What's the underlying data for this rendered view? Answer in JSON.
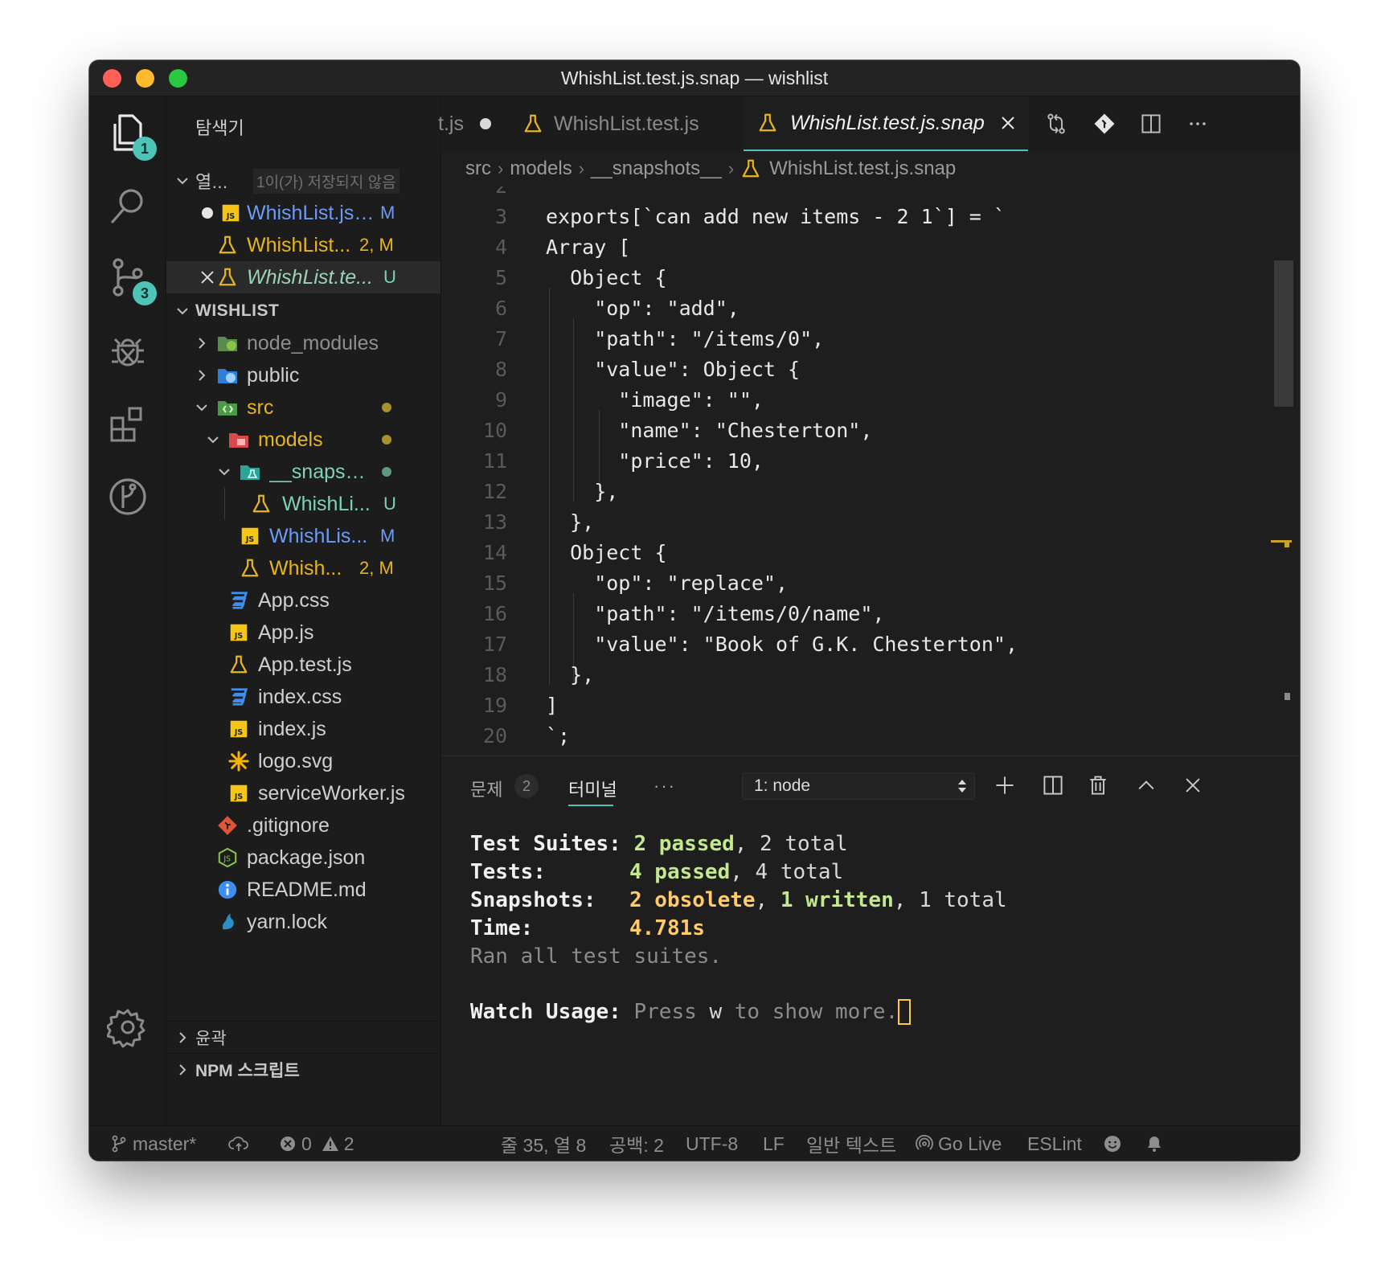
{
  "window": {
    "title": "WhishList.test.js.snap — wishlist"
  },
  "activity_bar": {
    "explorer_badge": "1",
    "scm_badge": "3"
  },
  "sidebar": {
    "header": "탐색기",
    "open_editors": {
      "title": "열...",
      "unsaved_note": "1이(가) 저장되지 않음",
      "items": [
        {
          "name": "WhishList.js ...",
          "status": "M"
        },
        {
          "name": "WhishList...",
          "status": "2, M"
        },
        {
          "name": "WhishList.te...",
          "status": "U"
        }
      ]
    },
    "project": {
      "title": "WISHLIST",
      "items": [
        {
          "name": "node_modules"
        },
        {
          "name": "public"
        },
        {
          "name": "src"
        },
        {
          "name": "models"
        },
        {
          "name": "__snapsh..."
        },
        {
          "name": "WhishLi...",
          "status": "U"
        },
        {
          "name": "WhishLis...",
          "status": "M"
        },
        {
          "name": "Whish...",
          "status": "2, M"
        },
        {
          "name": "App.css"
        },
        {
          "name": "App.js"
        },
        {
          "name": "App.test.js"
        },
        {
          "name": "index.css"
        },
        {
          "name": "index.js"
        },
        {
          "name": "logo.svg"
        },
        {
          "name": "serviceWorker.js"
        },
        {
          "name": ".gitignore"
        },
        {
          "name": "package.json"
        },
        {
          "name": "README.md"
        },
        {
          "name": "yarn.lock"
        }
      ]
    },
    "outline": "윤곽",
    "npm_scripts": "NPM 스크립트"
  },
  "tabs": [
    {
      "label": "t.js"
    },
    {
      "label": "WhishList.test.js"
    },
    {
      "label": "WhishList.test.js.snap"
    }
  ],
  "breadcrumb": [
    "src",
    "models",
    "__snapshots__",
    "WhishList.test.js.snap"
  ],
  "editor": {
    "lines": [
      {
        "n": "2",
        "text": ""
      },
      {
        "n": "3",
        "text": "exports[`can add new items - 2 1`] = `"
      },
      {
        "n": "4",
        "text": "Array ["
      },
      {
        "n": "5",
        "text": "  Object {"
      },
      {
        "n": "6",
        "text": "    \"op\": \"add\","
      },
      {
        "n": "7",
        "text": "    \"path\": \"/items/0\","
      },
      {
        "n": "8",
        "text": "    \"value\": Object {"
      },
      {
        "n": "9",
        "text": "      \"image\": \"\","
      },
      {
        "n": "10",
        "text": "      \"name\": \"Chesterton\","
      },
      {
        "n": "11",
        "text": "      \"price\": 10,"
      },
      {
        "n": "12",
        "text": "    },"
      },
      {
        "n": "13",
        "text": "  },"
      },
      {
        "n": "14",
        "text": "  Object {"
      },
      {
        "n": "15",
        "text": "    \"op\": \"replace\","
      },
      {
        "n": "16",
        "text": "    \"path\": \"/items/0/name\","
      },
      {
        "n": "17",
        "text": "    \"value\": \"Book of G.K. Chesterton\","
      },
      {
        "n": "18",
        "text": "  },"
      },
      {
        "n": "19",
        "text": "]"
      },
      {
        "n": "20",
        "text": "`;"
      }
    ]
  },
  "panel": {
    "problems_label": "문제",
    "problems_count": "2",
    "terminal_label": "터미널",
    "more": "···",
    "terminal_select": "1: node",
    "terminal": {
      "suites_label": "Test Suites:",
      "suites_passed": "2 passed",
      "suites_total": "2 total",
      "tests_label": "Tests:",
      "tests_passed": "4 passed",
      "tests_total": "4 total",
      "snapshots_label": "Snapshots:",
      "snapshots_obsolete": "2 obsolete",
      "snapshots_written": "1 written",
      "snapshots_total": "1 total",
      "time_label": "Time:",
      "time_value": "4.781s",
      "ran": "Ran all test suites.",
      "watch_label": "Watch Usage:",
      "watch_press": "Press",
      "watch_key": "w",
      "watch_rest": "to show more."
    }
  },
  "status_bar": {
    "branch": "master*",
    "errors": "0",
    "warnings": "2",
    "position": "줄 35, 열 8",
    "spaces": "공백: 2",
    "encoding": "UTF-8",
    "eol": "LF",
    "language": "일반 텍스트",
    "go_live": "Go Live",
    "eslint": "ESLint"
  },
  "colors": {
    "accent": "#4ec3b8",
    "modified_blue": "#6e9bf5",
    "test_yellow": "#e5b522",
    "untracked_green": "#7fd3b5"
  }
}
